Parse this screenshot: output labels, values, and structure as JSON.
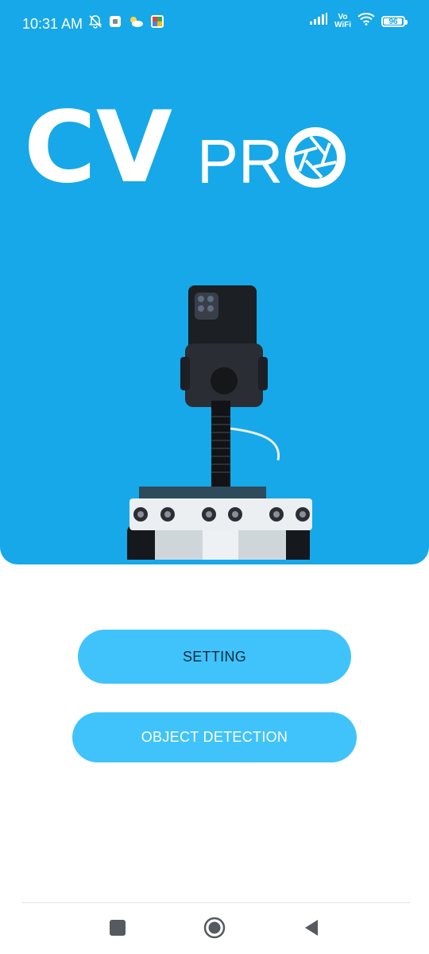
{
  "status_bar": {
    "time": "10:31 AM",
    "network_label_top": "Vo",
    "network_label_bottom": "WiFi",
    "battery_level": "96",
    "battery_fraction": 0.96,
    "icons": [
      "bell-off-icon",
      "notification-app-icon",
      "weather-icon",
      "photos-app-icon",
      "signal-icon",
      "wifi-icon",
      "battery-icon"
    ]
  },
  "hero": {
    "logo_main": "CV",
    "logo_sub": "PRO",
    "background_color": "#16a8e8"
  },
  "buttons": {
    "setting_label": "SETTING",
    "object_detection_label": "OBJECT DETECTION",
    "color": "#40c3fb"
  },
  "nav_bar": {
    "icons": [
      "recents-square-icon",
      "home-circle-icon",
      "back-triangle-icon"
    ]
  }
}
